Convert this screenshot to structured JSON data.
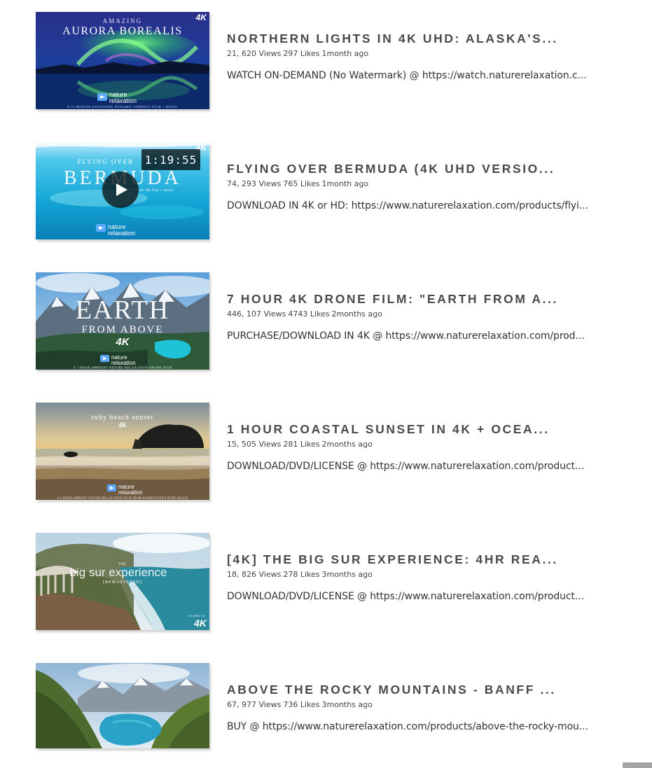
{
  "videos": [
    {
      "title": "NORTHERN LIGHTS IN 4K UHD: ALASKA'S...",
      "views": "21, 620 Views",
      "likes": "297 Likes",
      "age": "1month ago",
      "description": "WATCH ON-DEMAND (No Watermark) @ https://watch.naturerelaxation.c...",
      "thumb": {
        "overline": "AMAZING",
        "headline": "AURORA BOREALIS",
        "badge": "4K",
        "brand_line1": "nature",
        "brand_line2": "relaxation",
        "caption": "A 72 MINUTE SIGNATURE DYNAMIC AMBIENT FILM + MUSIC"
      }
    },
    {
      "title": "FLYING OVER BERMUDA (4K UHD VERSIO...",
      "views": "74, 293 Views",
      "likes": "765 Likes",
      "age": "1month ago",
      "description": "DOWNLOAD IN 4K or HD: https://www.naturerelaxation.com/products/flyi...",
      "thumb": {
        "overline": "FLYING OVER",
        "headline": "BERMUDA",
        "badge": "4K",
        "duration": "1:19:55",
        "sub": "an 80 minute 4K film + music",
        "brand_line1": "nature",
        "brand_line2": "relaxation"
      }
    },
    {
      "title": "7 HOUR 4K DRONE FILM: \"EARTH FROM A...",
      "views": "446, 107 Views",
      "likes": "4743 Likes",
      "age": "2months ago",
      "description": "PURCHASE/DOWNLOAD IN 4K @ https://www.naturerelaxation.com/prod...",
      "thumb": {
        "headline": "EARTH",
        "sub": "FROM ABOVE",
        "badge": "4K",
        "brand_line1": "nature",
        "brand_line2": "relaxation",
        "caption": "A 7 HOUR AMBIENT NATURE RELAXATION DRONE FILM"
      }
    },
    {
      "title": "1 HOUR COASTAL SUNSET IN 4K + OCEA...",
      "views": "15, 505 Views",
      "likes": "281 Likes",
      "age": "2months ago",
      "description": "DOWNLOAD/DVD/LICENSE @ https://www.naturerelaxation.com/product...",
      "thumb": {
        "headline": "ruby beach sunset",
        "badge": "4K",
        "brand_line1": "nature",
        "brand_line2": "relaxation",
        "caption": "A 1 HOUR AMBIENT NATURE RELAXATION FILM FROM WASHINGTON'S RUBY BEACH"
      }
    },
    {
      "title": "[4K] THE BIG SUR EXPERIENCE: 4HR REA...",
      "views": "18, 826 Views",
      "likes": "278 Likes",
      "age": "3months ago",
      "description": "DOWNLOAD/DVD/LICENSE @ https://www.naturerelaxation.com/product...",
      "thumb": {
        "overline": "THE",
        "headline": "big sur experience",
        "sub": "[REMASTERED]",
        "badge": "4K",
        "badge_caption": "FILMED IN"
      }
    },
    {
      "title": "ABOVE THE ROCKY MOUNTAINS - BANFF ...",
      "views": "67, 977 Views",
      "likes": "736 Likes",
      "age": "3months ago",
      "description": "BUY @ https://www.naturerelaxation.com/products/above-the-rocky-mou...",
      "thumb": {}
    }
  ],
  "colors": {
    "title": "#4a4a4a",
    "meta": "#444444",
    "description": "#333333",
    "scroll_button": "#a4a4a4"
  },
  "icons": {
    "play": "play-icon",
    "brand": "nature-relaxation-logo-icon"
  }
}
